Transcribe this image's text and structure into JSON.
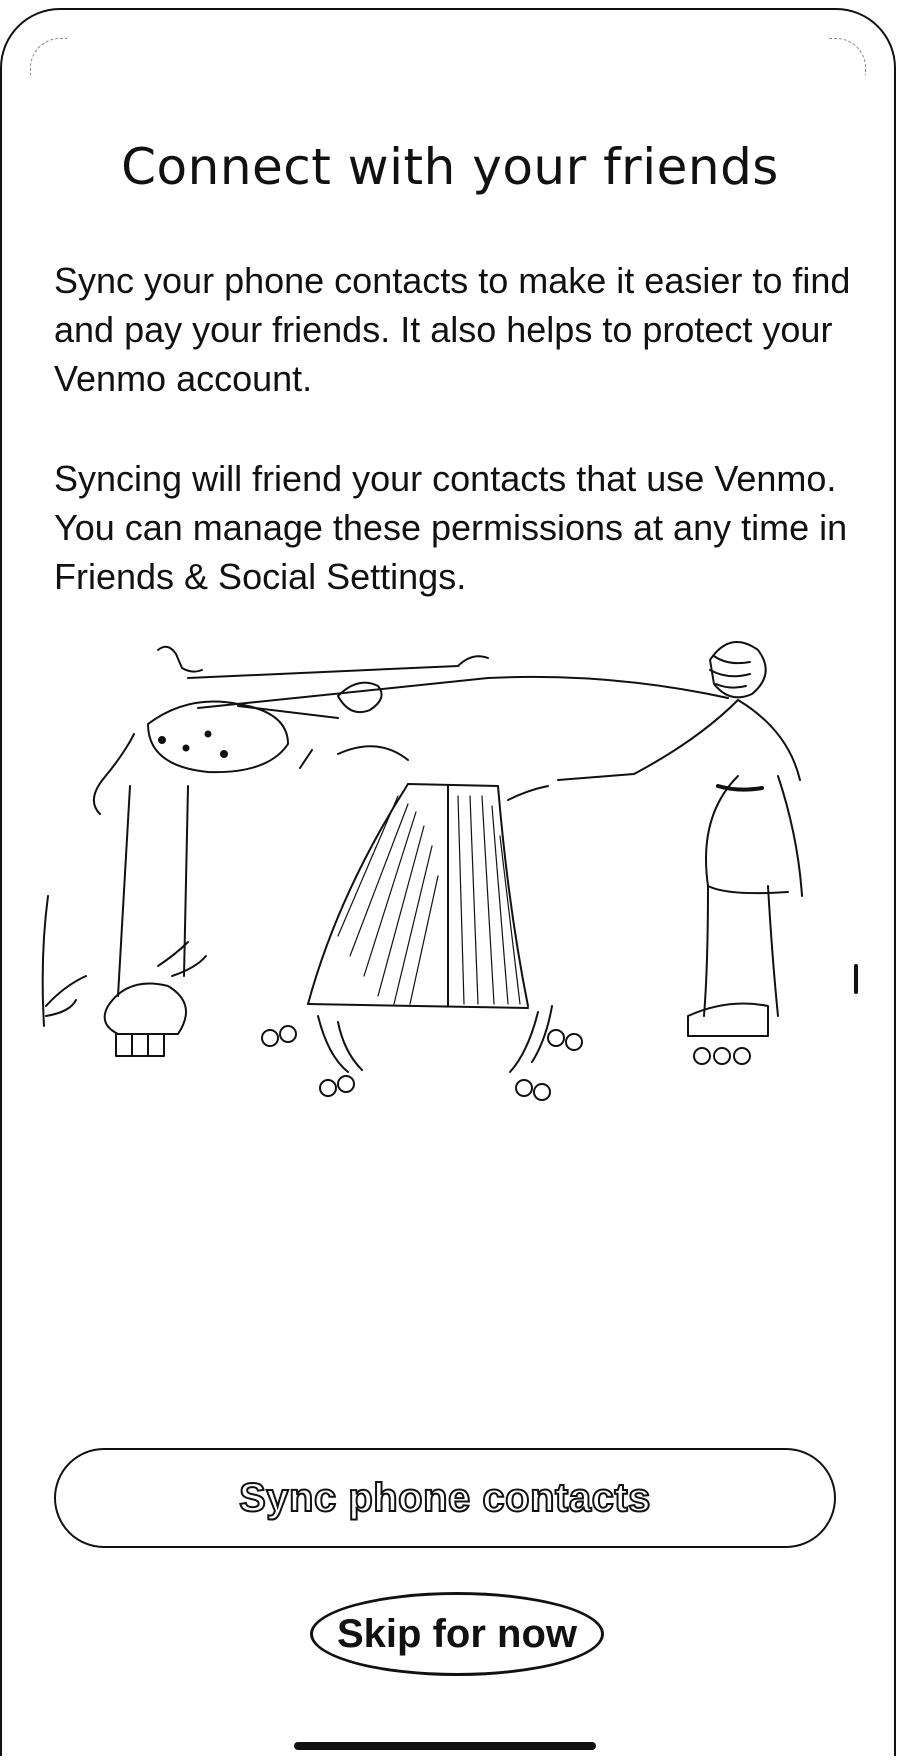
{
  "screen": {
    "title": "Connect with your friends",
    "paragraphs": [
      "Sync your phone contacts to make it easier to find and pay your friends. It also helps to protect your Venmo account.",
      "Syncing will friend your contacts that use Venmo. You can manage these permissions at any time in Friends & Social Settings."
    ]
  },
  "illustration": {
    "icon": "friends-skating-illustration"
  },
  "actions": {
    "primary_label": "Sync phone contacts",
    "secondary_label": "Skip for now"
  },
  "colors": {
    "ink": "#111111",
    "background": "#ffffff"
  }
}
